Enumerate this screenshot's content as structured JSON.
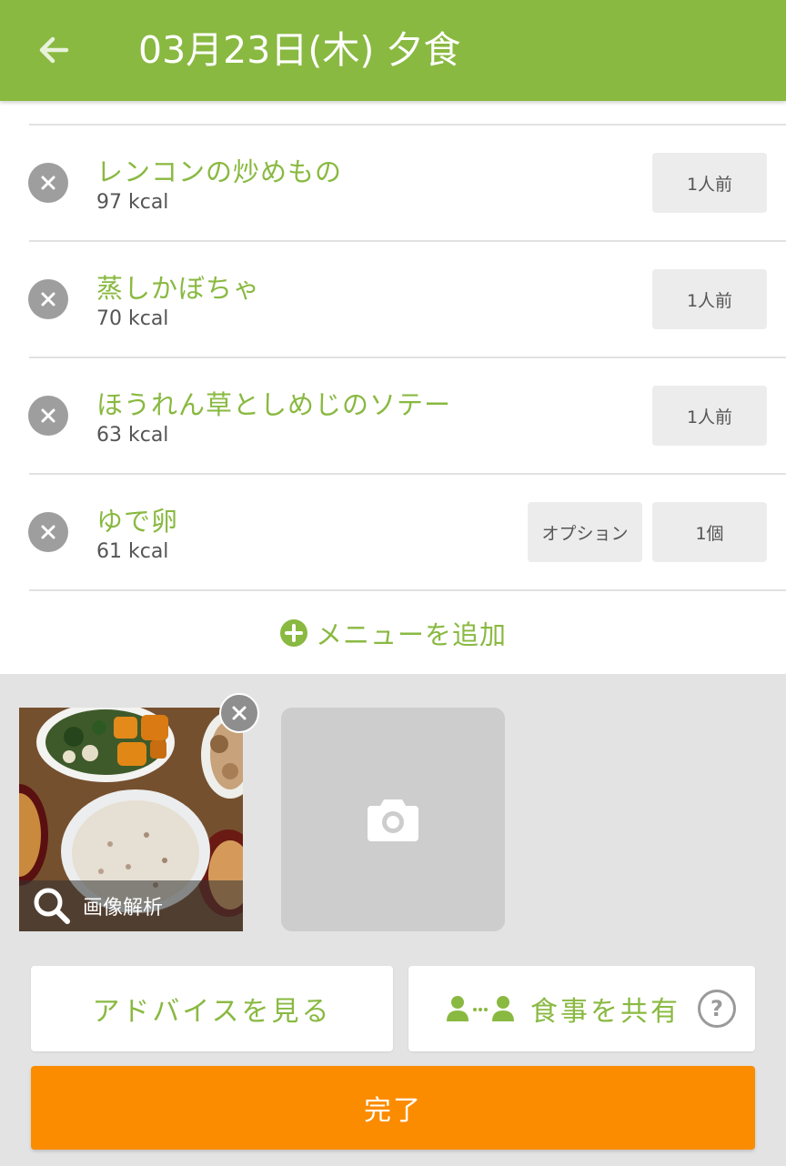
{
  "header": {
    "title": "03月23日(木) 夕食",
    "back_icon": "arrow-left-icon",
    "bg_color": "#89b941"
  },
  "items": [
    {
      "name": "レンコンの炒めもの",
      "kcal": "97 kcal",
      "portion": "1人前"
    },
    {
      "name": "蒸しかぼちゃ",
      "kcal": "70 kcal",
      "portion": "1人前"
    },
    {
      "name": "ほうれん草としめじのソテー",
      "kcal": "63 kcal",
      "portion": "1人前"
    },
    {
      "name": "ゆで卵",
      "kcal": "61 kcal",
      "option": "オプション",
      "portion": "1個"
    }
  ],
  "add_menu": {
    "label": "メニューを追加",
    "icon": "plus-circle-icon"
  },
  "photos": {
    "analyze_label": "画像解析",
    "analyze_icon": "search-icon",
    "remove_icon": "close-icon",
    "add_photo_icon": "camera-icon"
  },
  "buttons": {
    "advice": "アドバイスを見る",
    "share": "食事を共有",
    "share_icon": "people-share-icon",
    "help_icon": "question-circle-icon",
    "help_glyph": "?",
    "done": "完了"
  },
  "colors": {
    "accent_green": "#89b941",
    "done_orange": "#fb8c00",
    "remove_gray": "#9e9e9e"
  }
}
